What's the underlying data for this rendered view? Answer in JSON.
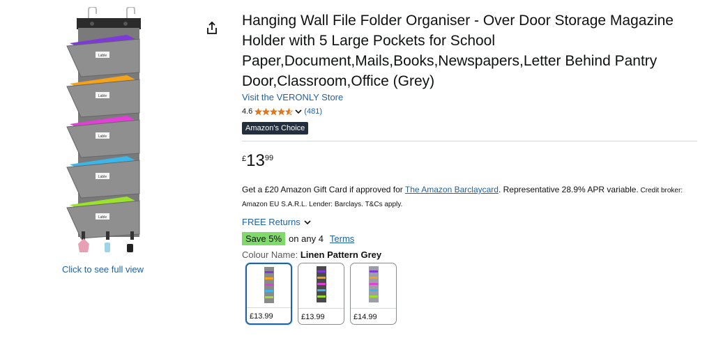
{
  "gallery": {
    "image_icon": "hanging-wall-file-organiser-image",
    "pocket_label": "Lable",
    "see_full_view": "Click to see full view",
    "share_icon": "share-icon"
  },
  "product": {
    "title": "Hanging Wall File Folder Organiser - Over Door Storage Magazine Holder with 5 Large Pockets for School Paper,Document,Mails,Books,Newspapers,Letter Behind Pantry Door,Classroom,Office (Grey)",
    "store_link": "Visit the VERONLY Store",
    "rating": "4.6",
    "stars_value": 4.6,
    "rating_count": "(481)",
    "badge": "Amazon's Choice"
  },
  "price": {
    "symbol": "£",
    "whole": "13",
    "fraction": "99"
  },
  "offer": {
    "prefix": "Get a £20 Amazon Gift Card if approved for ",
    "link": "The Amazon Barclaycard",
    "middle": ". Representative 28.9% APR variable.",
    "small": " Credit broker: Amazon EU S.A.R.L. Lender: Barclays. T&Cs apply."
  },
  "returns": {
    "label": "FREE Returns"
  },
  "save": {
    "badge": "Save 5%",
    "text": "on any 4",
    "terms": "Terms"
  },
  "colour": {
    "label": "Colour Name: ",
    "value": "Linen Pattern Grey"
  },
  "swatches": [
    {
      "price": "£13.99",
      "selected": true,
      "color": "#8a8a8a"
    },
    {
      "price": "£13.99",
      "selected": false,
      "color": "#4a4a4a"
    },
    {
      "price": "£14.99",
      "selected": false,
      "color": "#9e9eaa"
    }
  ],
  "colors": {
    "pocket_grey": "#8f8f8f",
    "pocket_colors": [
      "#7d3ad9",
      "#f5a21b",
      "#e13fd6",
      "#3bb6e8",
      "#9be22d"
    ],
    "link": "#2162a1",
    "star": "#de7921",
    "save_badge": "#7fda69",
    "badge_bg": "#232f3e"
  }
}
